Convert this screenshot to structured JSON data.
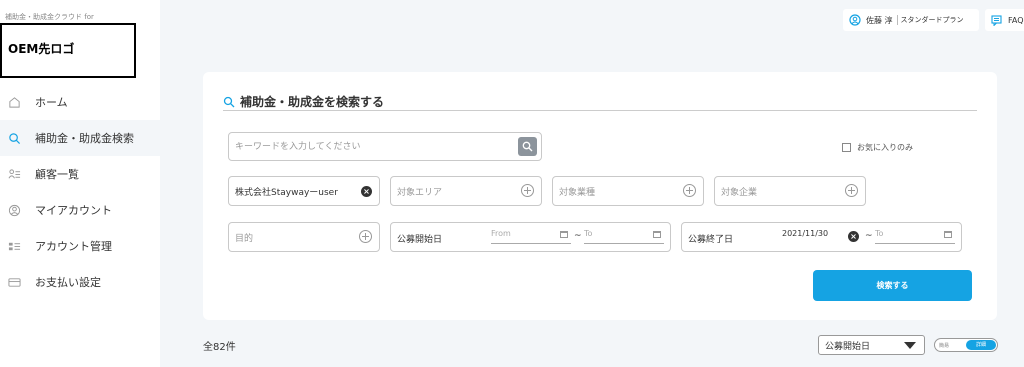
{
  "sidebar": {
    "caption": "補助金・助成金クラウド for",
    "logo": "OEM先ロゴ",
    "items": [
      {
        "label": "ホーム",
        "icon": "home-icon"
      },
      {
        "label": "補助金・助成金検索",
        "icon": "search-icon",
        "active": true
      },
      {
        "label": "顧客一覧",
        "icon": "customer-list-icon"
      },
      {
        "label": "マイアカウント",
        "icon": "account-icon"
      },
      {
        "label": "アカウント管理",
        "icon": "account-manage-icon"
      },
      {
        "label": "お支払い設定",
        "icon": "payment-icon"
      }
    ]
  },
  "header": {
    "user_name": "佐藤 淳",
    "plan": "スタンダードプラン",
    "faq": "FAQ"
  },
  "search": {
    "title": "補助金・助成金を検索する",
    "keyword_placeholder": "キーワードを入力してください",
    "favorites_label": "お気に入りのみ",
    "company_value": "株式会社Staywayーuser",
    "area_placeholder": "対象エリア",
    "industry_placeholder": "対象業種",
    "target_company_placeholder": "対象企業",
    "purpose_placeholder": "目的",
    "start_label": "公募開始日",
    "start_from_placeholder": "From",
    "start_to_placeholder": "To",
    "end_label": "公募終了日",
    "end_from_value": "2021/11/30",
    "end_to_placeholder": "To",
    "tilde": "~",
    "submit_label": "検索する"
  },
  "results": {
    "count": "全82件",
    "sort_value": "公募開始日",
    "view_simple": "簡易",
    "view_detail": "詳細"
  },
  "colors": {
    "accent": "#15a3e3",
    "background": "#f3f6f9"
  }
}
